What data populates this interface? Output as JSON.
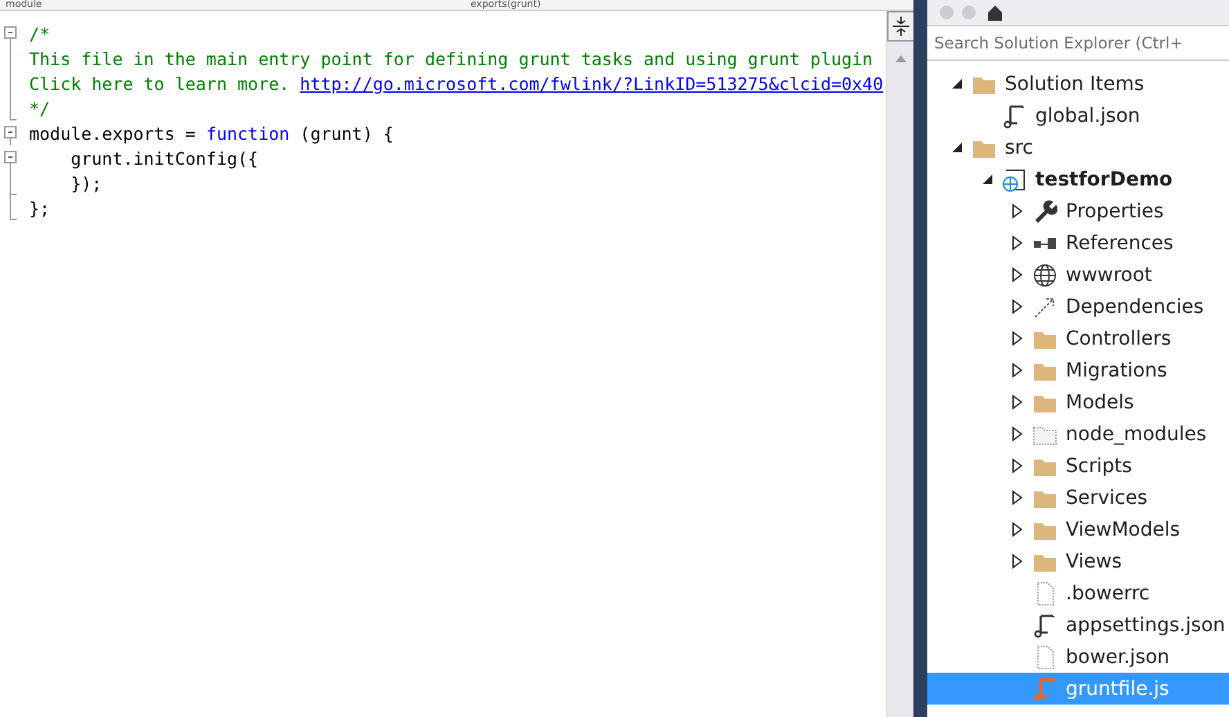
{
  "navigation_bar": {
    "left": "module",
    "right": "exports(grunt)"
  },
  "editor": {
    "lines": [
      {
        "kind": "open",
        "tokens": [
          {
            "kind": "comment",
            "text": "/*"
          }
        ]
      },
      {
        "kind": "line",
        "tokens": [
          {
            "kind": "comment",
            "text": "This file in the main entry point for defining grunt tasks and using grunt plugin"
          }
        ]
      },
      {
        "kind": "line",
        "tokens": [
          {
            "kind": "comment",
            "text": "Click here to learn more. "
          },
          {
            "kind": "link",
            "text": "http://go.microsoft.com/fwlink/?LinkID=513275&clcid=0x40"
          }
        ]
      },
      {
        "kind": "end",
        "tokens": [
          {
            "kind": "comment",
            "text": "*/"
          }
        ]
      },
      {
        "kind": "open",
        "tokens": [
          {
            "kind": "plain",
            "text": "module.exports = "
          },
          {
            "kind": "keyword",
            "text": "function"
          },
          {
            "kind": "plain",
            "text": " (grunt) {"
          }
        ]
      },
      {
        "kind": "open",
        "tokens": [
          {
            "kind": "plain",
            "text": "    grunt.initConfig({"
          }
        ]
      },
      {
        "kind": "end",
        "tokens": [
          {
            "kind": "plain",
            "text": "    });"
          }
        ]
      },
      {
        "kind": "end",
        "tokens": [
          {
            "kind": "plain",
            "text": "};"
          }
        ]
      }
    ]
  },
  "solution_explorer": {
    "search": {
      "placeholder": "Search Solution Explorer (Ctrl+"
    },
    "tree": [
      {
        "label": "Solution Items",
        "kind": "folder",
        "expanded": true,
        "selected": false,
        "children": [
          {
            "label": "global.json",
            "kind": "script",
            "selected": false
          }
        ]
      },
      {
        "label": "src",
        "kind": "folder",
        "expanded": true,
        "selected": false,
        "children": [
          {
            "label": "testforDemo",
            "kind": "project",
            "bold": true,
            "expanded": true,
            "selected": false,
            "children": [
              {
                "label": "Properties",
                "kind": "wrench",
                "expanded": false,
                "selected": false
              },
              {
                "label": "References",
                "kind": "references",
                "expanded": false,
                "selected": false
              },
              {
                "label": "wwwroot",
                "kind": "globe",
                "expanded": false,
                "selected": false
              },
              {
                "label": "Dependencies",
                "kind": "dependencies",
                "expanded": false,
                "selected": false
              },
              {
                "label": "Controllers",
                "kind": "folder",
                "expanded": false,
                "selected": false
              },
              {
                "label": "Migrations",
                "kind": "folder",
                "expanded": false,
                "selected": false
              },
              {
                "label": "Models",
                "kind": "folder",
                "expanded": false,
                "selected": false
              },
              {
                "label": "node_modules",
                "kind": "dotted-folder",
                "expanded": false,
                "selected": false
              },
              {
                "label": "Scripts",
                "kind": "folder",
                "expanded": false,
                "selected": false
              },
              {
                "label": "Services",
                "kind": "folder",
                "expanded": false,
                "selected": false
              },
              {
                "label": "ViewModels",
                "kind": "folder",
                "expanded": false,
                "selected": false
              },
              {
                "label": "Views",
                "kind": "folder",
                "expanded": false,
                "selected": false
              },
              {
                "label": ".bowerrc",
                "kind": "file",
                "selected": false
              },
              {
                "label": "appsettings.json",
                "kind": "script",
                "selected": false
              },
              {
                "label": "bower.json",
                "kind": "file",
                "selected": false
              },
              {
                "label": "gruntfile.js",
                "kind": "script-orange",
                "selected": true
              }
            ]
          }
        ]
      }
    ]
  }
}
